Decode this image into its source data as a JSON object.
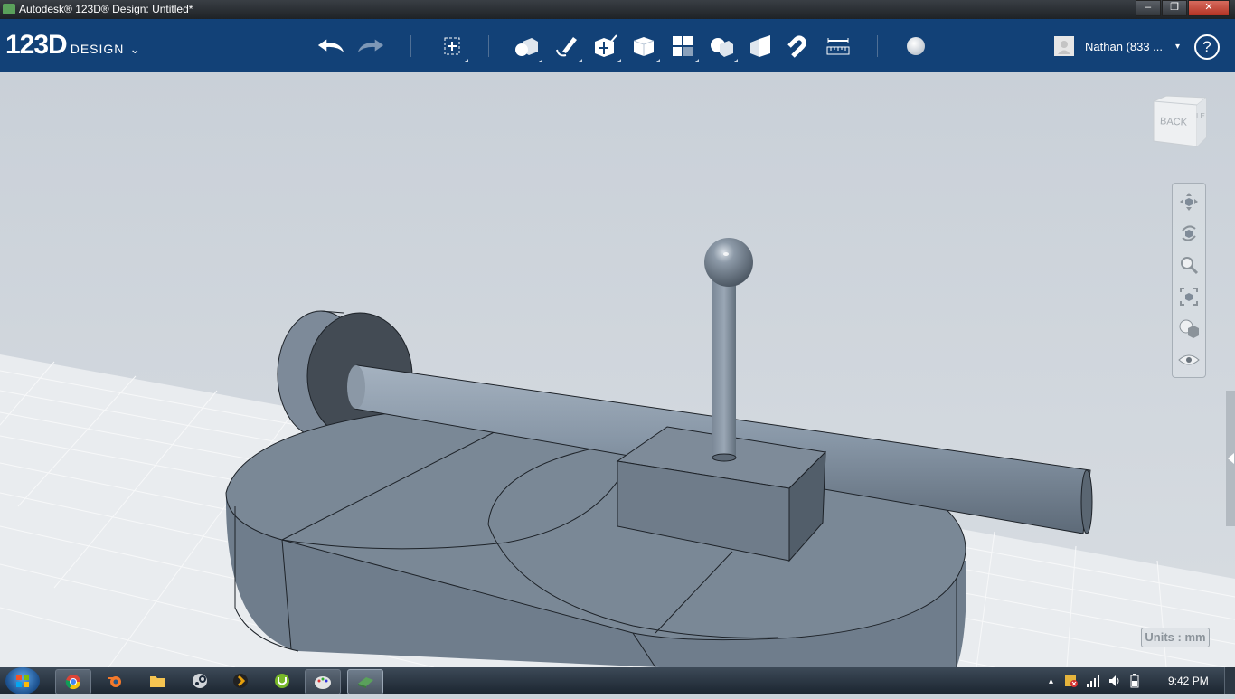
{
  "window": {
    "title": "Autodesk® 123D® Design: Untitled*",
    "min": "–",
    "max": "❐",
    "close": "✕"
  },
  "app": {
    "logo_num": "123D",
    "logo_word": "DESIGN",
    "logo_caret": "⌄"
  },
  "toolbar": {
    "buttons": [
      {
        "name": "undo-button",
        "icon": "undo-icon"
      },
      {
        "name": "redo-button",
        "icon": "redo-icon"
      },
      {
        "name": "transform-button",
        "icon": "transform-icon"
      },
      {
        "name": "primitives-button",
        "icon": "primitives-icon"
      },
      {
        "name": "sketch-button",
        "icon": "sketch-icon"
      },
      {
        "name": "construct-button",
        "icon": "construct-icon"
      },
      {
        "name": "modify-button",
        "icon": "modify-icon"
      },
      {
        "name": "pattern-button",
        "icon": "pattern-icon"
      },
      {
        "name": "group-button",
        "icon": "group-icon"
      },
      {
        "name": "combine-button",
        "icon": "combine-icon"
      },
      {
        "name": "snap-button",
        "icon": "snap-icon"
      },
      {
        "name": "measure-button",
        "icon": "measure-icon"
      },
      {
        "name": "material-button",
        "icon": "material-icon"
      }
    ]
  },
  "user": {
    "name": "Nathan  (833 ...",
    "caret": "▾"
  },
  "help": {
    "label": "?"
  },
  "viewcube": {
    "face_label": "BACK",
    "side_label": "LE"
  },
  "units": {
    "label": "Units : mm"
  },
  "taskbar": {
    "clock": "9:42 PM",
    "tray_caret": "▴"
  },
  "colors": {
    "toolbar": "#124177",
    "viewport": "#cbd2d9",
    "model": "#7a8896"
  }
}
